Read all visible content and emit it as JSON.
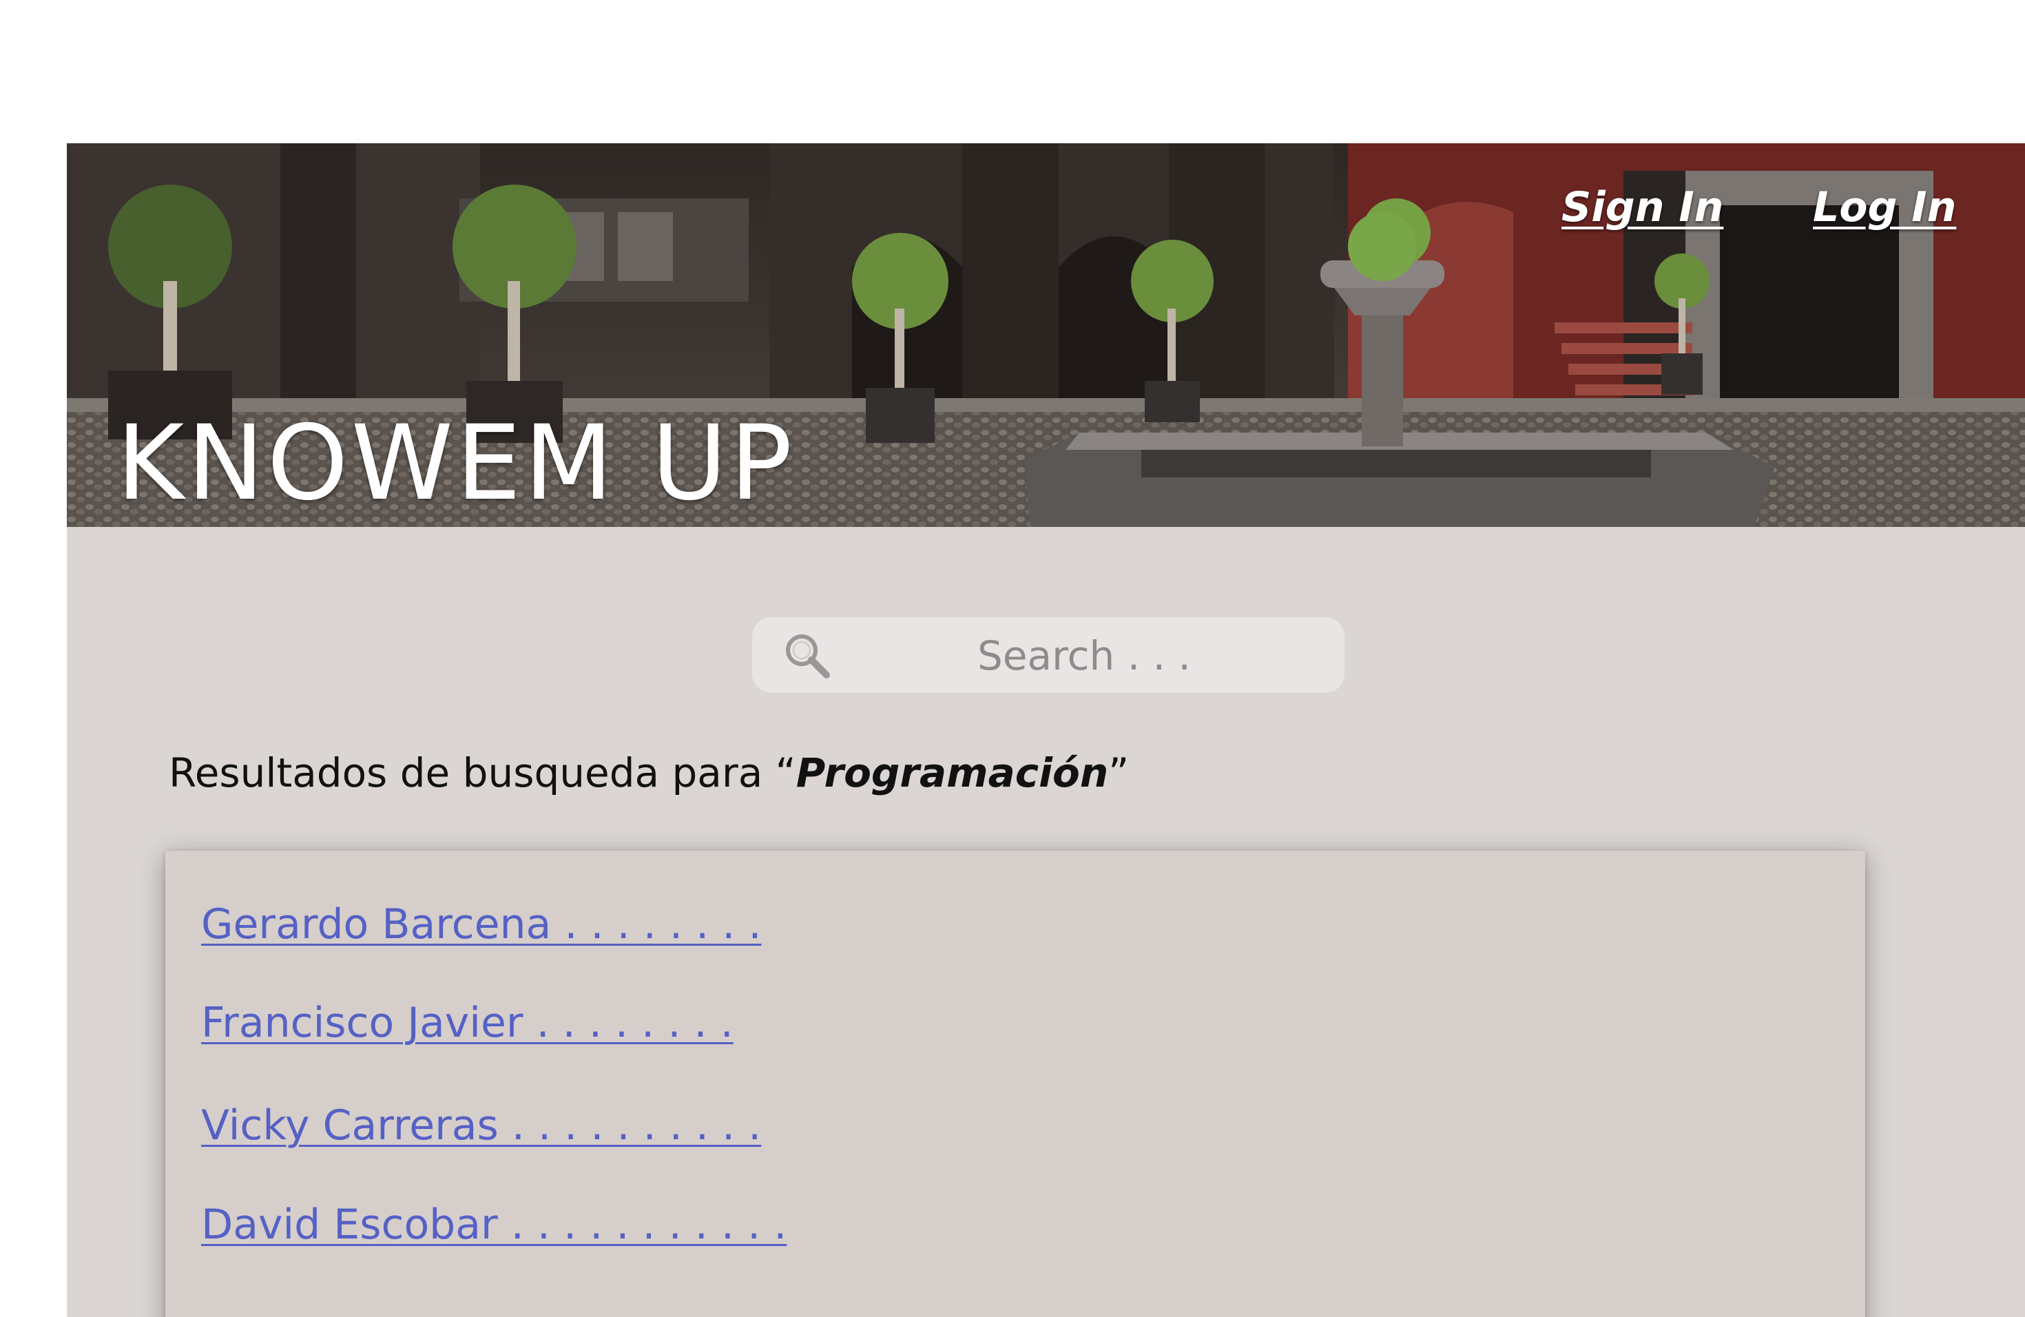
{
  "header": {
    "site_title": "KNOWEM UP",
    "nav": {
      "sign_in": "Sign In",
      "log_in": "Log In"
    }
  },
  "search": {
    "placeholder": "Search . . .",
    "value": ""
  },
  "results": {
    "heading_prefix": "Resultados de busqueda para “",
    "query": "Programación",
    "heading_suffix": "”",
    "items": [
      {
        "label": "Gerardo Barcena . . . . . . . ."
      },
      {
        "label": "Francisco Javier . . . . . . . ."
      },
      {
        "label": "Vicky Carreras . . . . . . . . . ."
      },
      {
        "label": "David Escobar . . . . . . . . . . ."
      }
    ]
  },
  "colors": {
    "content_background": "#dbd6d3",
    "results_panel": "#d6cecb",
    "search_box": "#e8e5e4",
    "link": "#5561c4",
    "hero_text": "#ffffff"
  },
  "icons": [
    "search-icon"
  ]
}
